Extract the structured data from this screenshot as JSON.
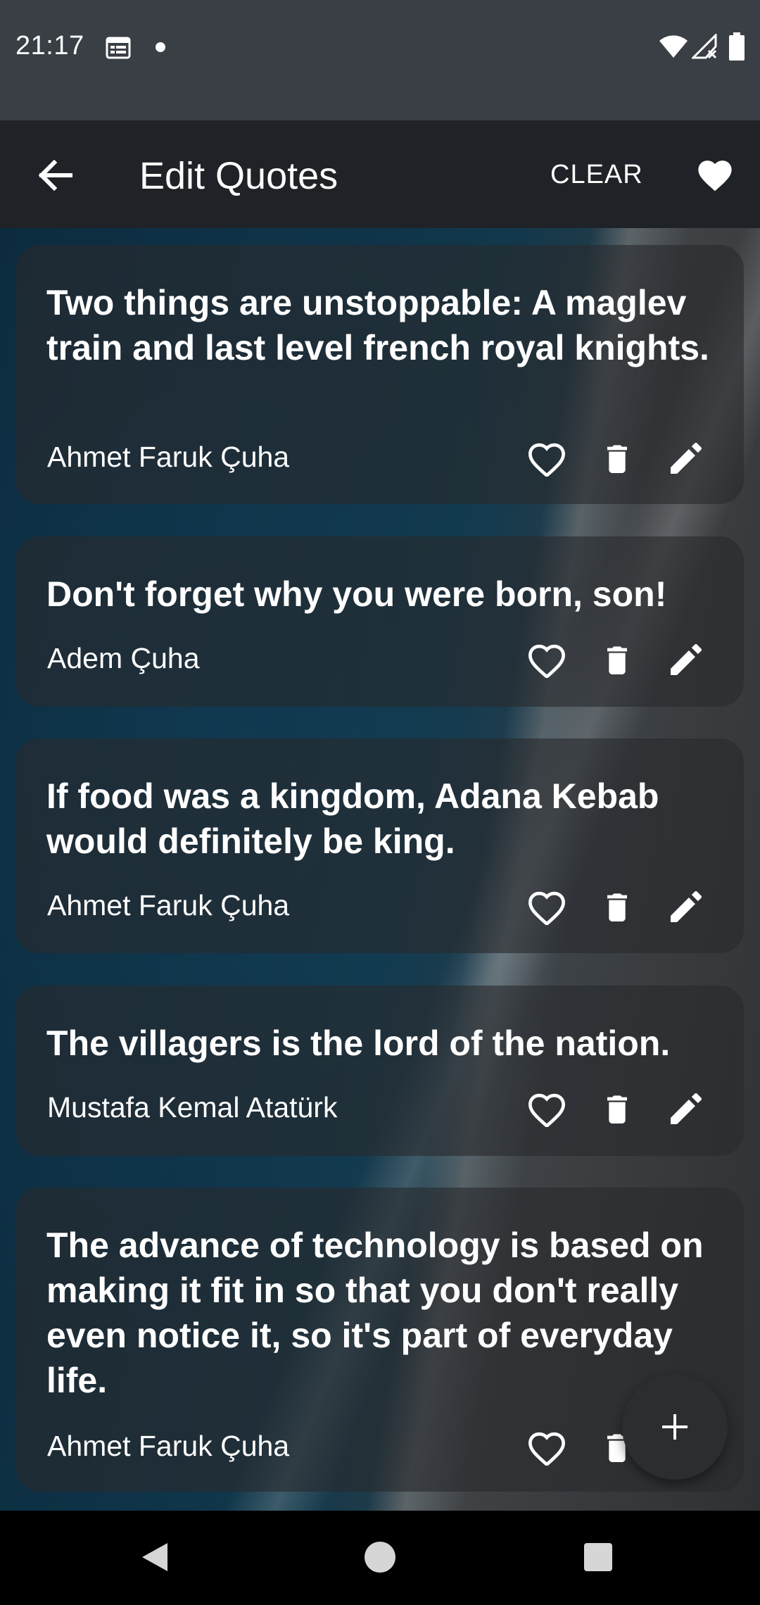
{
  "status_bar": {
    "time": "21:17"
  },
  "app_bar": {
    "title": "Edit Quotes",
    "clear_label": "CLEAR"
  },
  "quotes": [
    {
      "text": "Two things are unstoppable: A maglev train and last level french royal knights.",
      "author": "Ahmet Faruk Çuha"
    },
    {
      "text": "Don't forget why you were born, son!",
      "author": "Adem Çuha"
    },
    {
      "text": "If food was a kingdom, Adana Kebab would definitely be king.",
      "author": "Ahmet Faruk Çuha"
    },
    {
      "text": "The villagers is the lord of the nation.",
      "author": "Mustafa Kemal Atatürk"
    },
    {
      "text": "The advance of technology is based on making it fit in so that you don't really even notice it, so it's part of everyday life.",
      "author": "Ahmet Faruk Çuha"
    }
  ],
  "icons": {
    "back": "arrow-back-icon",
    "favorites": "heart-filled-icon",
    "favorite": "heart-outline-icon",
    "delete": "trash-icon",
    "edit": "pencil-icon",
    "add": "plus-icon"
  },
  "colors": {
    "status_bar": "#3a3e45",
    "app_bar": "#1f2226",
    "card": "#282a2d",
    "text": "#ffffff"
  }
}
